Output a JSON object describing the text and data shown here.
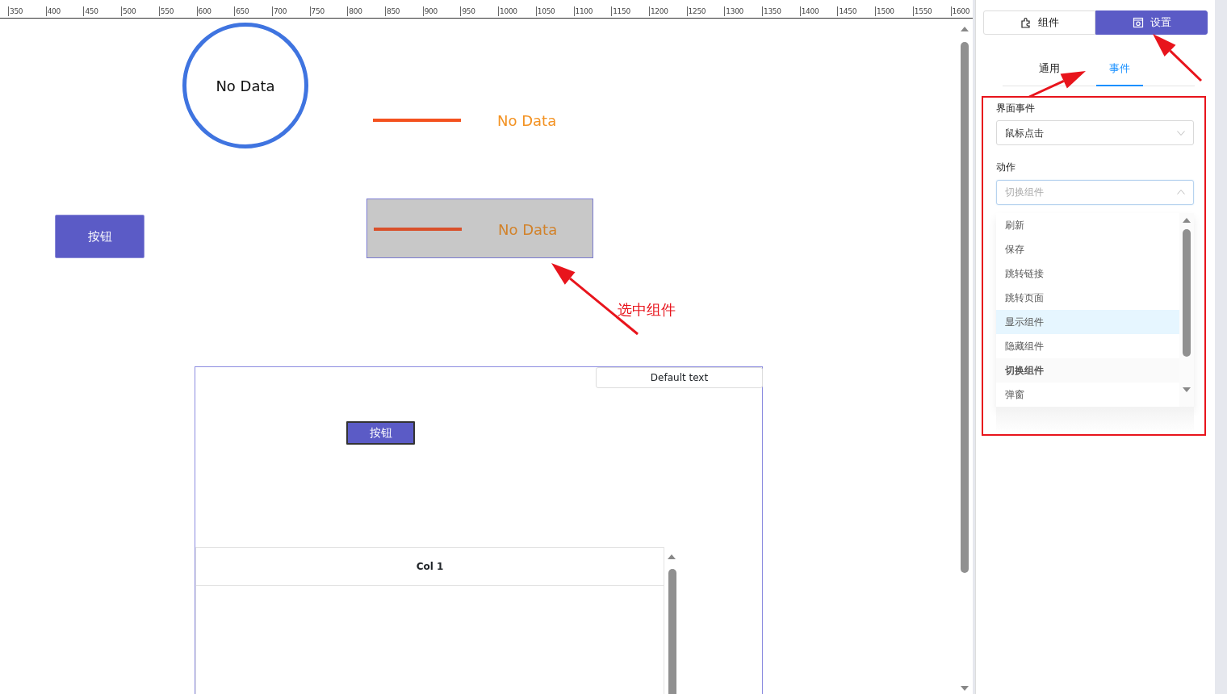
{
  "ruler": {
    "labels": [
      "350",
      "400",
      "450",
      "500",
      "550",
      "600",
      "650",
      "700",
      "750",
      "800",
      "850",
      "900",
      "950",
      "1000",
      "1050",
      "1100",
      "1150",
      "1200",
      "1250",
      "1300",
      "1350",
      "1400",
      "1450",
      "1500",
      "1550",
      "1600"
    ]
  },
  "canvas": {
    "widgets": [
      {
        "kind": "circle",
        "text": "No Data",
        "selected": false
      },
      {
        "kind": "line",
        "text": "No Data",
        "selected": false
      },
      {
        "kind": "button",
        "text": "按钮",
        "selected": false
      },
      {
        "kind": "line",
        "text": "No Data",
        "selected": true
      },
      {
        "kind": "container",
        "selected": false,
        "tab": "Default text",
        "button": "按钮",
        "table": {
          "columns": [
            "Col 1"
          ]
        }
      }
    ]
  },
  "annotation": {
    "label": "选中组件"
  },
  "panel": {
    "top_tabs": [
      {
        "label": "组件",
        "selected": false
      },
      {
        "label": "设置",
        "selected": true
      }
    ],
    "tabs": [
      {
        "label": "通用",
        "selected": false
      },
      {
        "label": "事件",
        "selected": true
      }
    ],
    "event_field": {
      "label": "界面事件",
      "value": "鼠标点击"
    },
    "action_field": {
      "label": "动作",
      "placeholder": "切换组件",
      "expanded": true
    },
    "options": [
      {
        "label": "刷新",
        "highlighted": false,
        "selected": false
      },
      {
        "label": "保存",
        "highlighted": false,
        "selected": false
      },
      {
        "label": "跳转链接",
        "highlighted": false,
        "selected": false
      },
      {
        "label": "跳转页面",
        "highlighted": false,
        "selected": false
      },
      {
        "label": "显示组件",
        "highlighted": true,
        "selected": false
      },
      {
        "label": "隐藏组件",
        "highlighted": false,
        "selected": false
      },
      {
        "label": "切换组件",
        "highlighted": false,
        "selected": true
      },
      {
        "label": "弹窗",
        "highlighted": false,
        "selected": false
      }
    ]
  }
}
